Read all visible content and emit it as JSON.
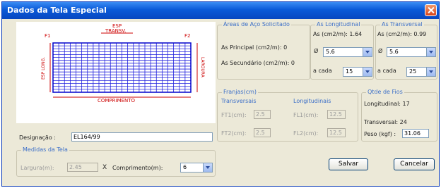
{
  "window": {
    "title": "Dados da Tela Especial"
  },
  "drawing": {
    "label_f1": "F1",
    "label_f2": "F2",
    "label_esp": "ESP",
    "label_transv": "TRANSV.",
    "label_esp_long": "ESP LONG.",
    "label_largura": "LARGURA",
    "label_comprimento": "COMPRIMENTO"
  },
  "areas": {
    "title": "Áreas de Aço Solicitado",
    "principal": "As Principal (cm2/m): 0",
    "secundario": "As Secundário (cm2/m): 0"
  },
  "longitudinal": {
    "title": "As Longitudinal",
    "as": "As (cm2/m): 1.64",
    "phi_label": "Ø",
    "phi_value": "5.6",
    "acada_label": "a cada",
    "acada_value": "15"
  },
  "transversal": {
    "title": "As Transversal",
    "as": "As (cm2/m): 0.99",
    "phi_label": "Ø",
    "phi_value": "5.6",
    "acada_label": "a cada",
    "acada_value": "25"
  },
  "franjas": {
    "title": "Franjas(cm)",
    "transversal": "Transversais",
    "longitudinal": "Longitudinais",
    "ft1_label": "FT1(cm):",
    "ft1_value": "2.5",
    "ft2_label": "FT2(cm):",
    "ft2_value": "2.5",
    "fl1_label": "FL1(cm):",
    "fl1_value": "12.5",
    "fl2_label": "FL2(cm):",
    "fl2_value": "12.5"
  },
  "fios": {
    "title": "Qtde de Fios",
    "longitudinal": "Longitudinal: 17",
    "transversal": "Transversal: 24",
    "peso_label": "Peso (kgf) :",
    "peso_value": "31.06"
  },
  "designacao": {
    "label": "Designação :",
    "value": "EL164/99"
  },
  "medidas": {
    "title": "Medidas da Tela",
    "largura_label": "Largura(m):",
    "largura_value": "2.45",
    "times": "X",
    "comprimento_label": "Comprimento(m):",
    "comprimento_value": "6"
  },
  "buttons": {
    "salvar": "Salvar",
    "cancelar": "Cancelar"
  }
}
